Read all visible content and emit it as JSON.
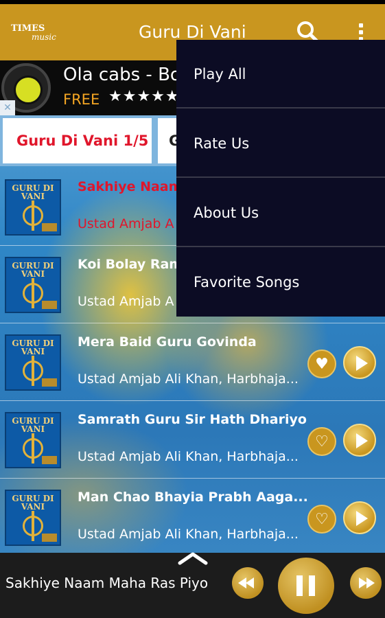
{
  "app_bar": {
    "logo_line1": "TIMES",
    "logo_line2": "music",
    "title": "Guru Di Vani"
  },
  "ad": {
    "title": "Ola cabs - Bo",
    "price": "FREE",
    "stars": "★★★★★",
    "close": "✕"
  },
  "tabs": [
    {
      "label": "Guru Di Vani 1/5",
      "active": true
    },
    {
      "label": "G",
      "active": false
    }
  ],
  "thumb_text": "GURU DI VANI",
  "songs": [
    {
      "title": "Sakhiye Naam",
      "artist": "Ustad Amjab A",
      "playing": true
    },
    {
      "title": "Koi Bolay Ram",
      "artist": "Ustad Amjab A",
      "playing": false
    },
    {
      "title": "Mera Baid Guru Govinda",
      "artist": "Ustad Amjab Ali Khan, Harbhaja...",
      "playing": false,
      "favorite": true
    },
    {
      "title": "Samrath Guru Sir Hath Dhariyo",
      "artist": "Ustad Amjab Ali Khan, Harbhaja...",
      "playing": false,
      "favorite": false
    },
    {
      "title": "Man Chao Bhayia Prabh Aaga...",
      "artist": "Ustad Amjab Ali Khan, Harbhaja...",
      "playing": false,
      "favorite": false
    }
  ],
  "menu": {
    "items": [
      "Play All",
      "Rate Us",
      "About Us",
      "Favorite Songs"
    ]
  },
  "player": {
    "now_playing": "Sakhiye Naam Maha Ras Piyo"
  },
  "colors": {
    "accent": "#c9961f",
    "active_red": "#e0162b",
    "menu_bg": "#0c0c24"
  }
}
